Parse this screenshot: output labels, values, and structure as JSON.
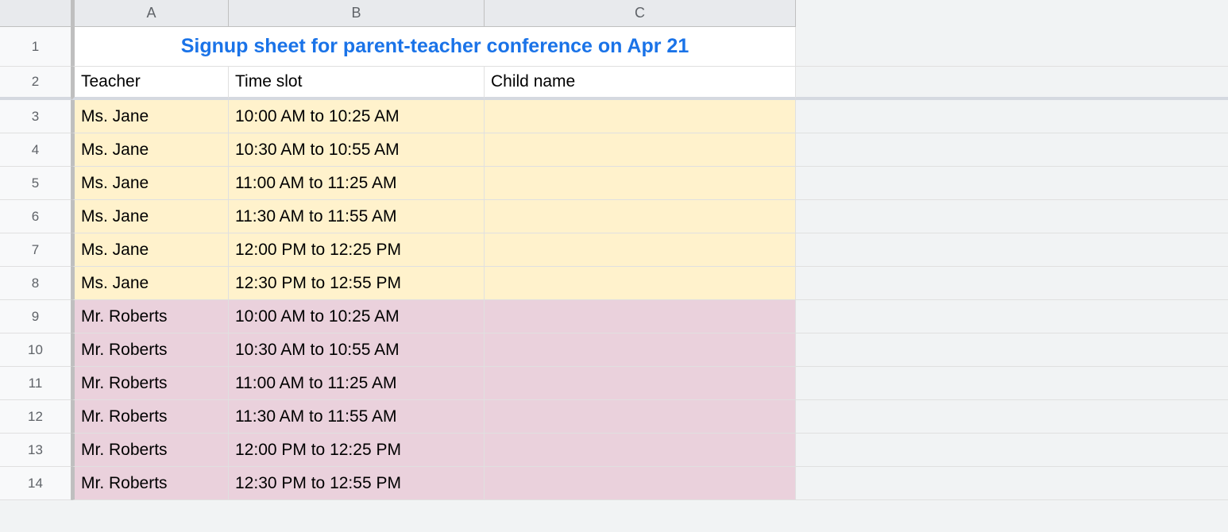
{
  "columns": [
    "A",
    "B",
    "C"
  ],
  "rowNumbers": [
    "1",
    "2",
    "3",
    "4",
    "5",
    "6",
    "7",
    "8",
    "9",
    "10",
    "11",
    "12",
    "13",
    "14"
  ],
  "title": "Signup sheet for parent-teacher conference on Apr 21",
  "headers": {
    "teacher": "Teacher",
    "timeslot": "Time slot",
    "childname": "Child name"
  },
  "rows": [
    {
      "teacher": "Ms. Jane",
      "timeslot": "10:00 AM to 10:25 AM",
      "childname": "",
      "color": "yellow"
    },
    {
      "teacher": "Ms. Jane",
      "timeslot": "10:30 AM to 10:55 AM",
      "childname": "",
      "color": "yellow"
    },
    {
      "teacher": "Ms. Jane",
      "timeslot": "11:00 AM to 11:25 AM",
      "childname": "",
      "color": "yellow"
    },
    {
      "teacher": "Ms. Jane",
      "timeslot": "11:30 AM to 11:55 AM",
      "childname": "",
      "color": "yellow"
    },
    {
      "teacher": "Ms. Jane",
      "timeslot": "12:00 PM to 12:25 PM",
      "childname": "",
      "color": "yellow"
    },
    {
      "teacher": "Ms. Jane",
      "timeslot": "12:30 PM to 12:55 PM",
      "childname": "",
      "color": "yellow"
    },
    {
      "teacher": "Mr. Roberts",
      "timeslot": "10:00 AM to 10:25 AM",
      "childname": "",
      "color": "pink"
    },
    {
      "teacher": "Mr. Roberts",
      "timeslot": "10:30 AM to 10:55 AM",
      "childname": "",
      "color": "pink"
    },
    {
      "teacher": "Mr. Roberts",
      "timeslot": "11:00 AM to 11:25 AM",
      "childname": "",
      "color": "pink"
    },
    {
      "teacher": "Mr. Roberts",
      "timeslot": "11:30 AM to 11:55 AM",
      "childname": "",
      "color": "pink"
    },
    {
      "teacher": "Mr. Roberts",
      "timeslot": "12:00 PM to 12:25 PM",
      "childname": "",
      "color": "pink"
    },
    {
      "teacher": "Mr. Roberts",
      "timeslot": "12:30 PM to 12:55 PM",
      "childname": "",
      "color": "pink"
    }
  ]
}
